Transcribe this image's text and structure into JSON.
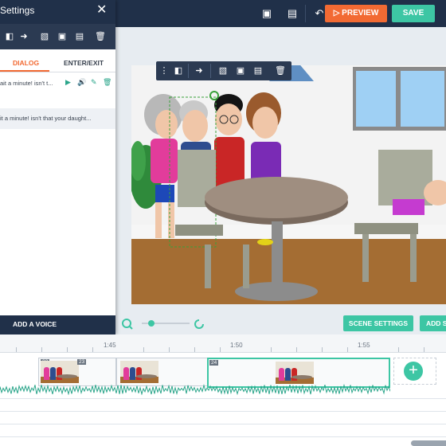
{
  "topbar": {
    "preview_label": "PREVIEW",
    "save_label": "SAVE",
    "icons": [
      "bring-forward-icon",
      "copy-icon",
      "undo-icon",
      "play-circle-icon"
    ]
  },
  "panel": {
    "title": "Settings",
    "tools": [
      "flip-icon",
      "walk-arrow-icon",
      "layer-icon",
      "duplicate-icon",
      "paste-icon",
      "trash-icon"
    ],
    "tabs": [
      {
        "label": "DIALOG"
      },
      {
        "label": "ENTER/EXIT"
      }
    ],
    "lines": [
      {
        "text": "ait a minute! isn't t..."
      },
      {
        "text": "it a minute! isn't that your daught..."
      }
    ],
    "add_voice_label": "ADD A VOICE"
  },
  "stage": {
    "scene_settings_label": "SCENE SETTINGS",
    "add_scene_label": "ADD S",
    "zoom_fraction": 0.2
  },
  "timeline": {
    "ticks": [
      "1:45",
      "1:50",
      "1:55"
    ],
    "scenes": [
      {
        "label": "22"
      },
      {
        "label": "23"
      },
      {
        "label": "24"
      }
    ],
    "add_symbol": "+"
  },
  "colors": {
    "navy": "#203049",
    "accent_orange": "#f26a33",
    "accent_green": "#3dc6a4"
  }
}
